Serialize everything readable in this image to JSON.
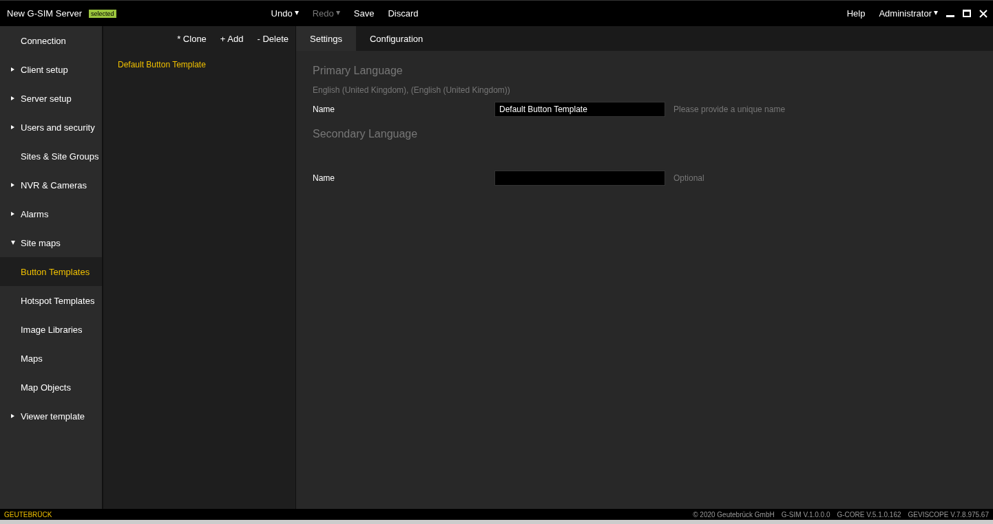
{
  "window": {
    "title": "New G-SIM Server",
    "badge": "selected"
  },
  "toolbar": [
    {
      "label": "Undo",
      "dropdown": true,
      "disabled": false
    },
    {
      "label": "Redo",
      "dropdown": true,
      "disabled": true
    },
    {
      "label": "Save",
      "dropdown": false,
      "disabled": false
    },
    {
      "label": "Discard",
      "dropdown": false,
      "disabled": false
    }
  ],
  "header_right": {
    "help": "Help",
    "user": "Administrator"
  },
  "sidebar": {
    "items": [
      {
        "label": "Connection",
        "selected": false
      },
      {
        "label": "Client setup",
        "selected": false,
        "expanded": false
      },
      {
        "label": "Server setup",
        "selected": false,
        "expanded": false
      },
      {
        "label": "Users and security",
        "selected": false,
        "expanded": false
      },
      {
        "label": "Sites & Site Groups",
        "selected": false
      },
      {
        "label": "NVR & Cameras",
        "selected": false,
        "expanded": false
      },
      {
        "label": "Alarms",
        "selected": false,
        "expanded": false
      },
      {
        "label": "Site maps",
        "selected": false,
        "expanded": true,
        "children": [
          {
            "label": "Button Templates",
            "selected": true
          },
          {
            "label": "Hotspot Templates",
            "selected": false
          },
          {
            "label": "Image Libraries",
            "selected": false
          },
          {
            "label": "Maps",
            "selected": false
          },
          {
            "label": "Map Objects",
            "selected": false
          }
        ]
      },
      {
        "label": "Viewer template",
        "selected": false,
        "expanded": false
      }
    ]
  },
  "list_panel": {
    "actions": [
      "* Clone",
      "+ Add",
      "- Delete"
    ],
    "items": [
      {
        "label": "Default Button Template",
        "selected": true
      }
    ]
  },
  "tabs": [
    {
      "label": "Settings",
      "selected": true
    },
    {
      "label": "Configuration",
      "selected": false
    }
  ],
  "sections": [
    {
      "heading": "Primary Language",
      "subtitle": "English (United Kingdom), (English (United Kingdom))",
      "field": {
        "label": "Name",
        "value": "Default Button Template",
        "hint": "Please provide a unique name"
      }
    },
    {
      "heading": "Secondary Language",
      "field": {
        "label": "Name",
        "hint": "Optional"
      }
    }
  ],
  "status_bar": {
    "brand": "GEUTEBRÜCK",
    "info": [
      "© 2020 Geutebrück GmbH",
      "G-SIM V.1.0.0.0",
      "G-CORE V.5.1.0.162",
      "GEVISCOPE V.7.8.975.67"
    ]
  }
}
